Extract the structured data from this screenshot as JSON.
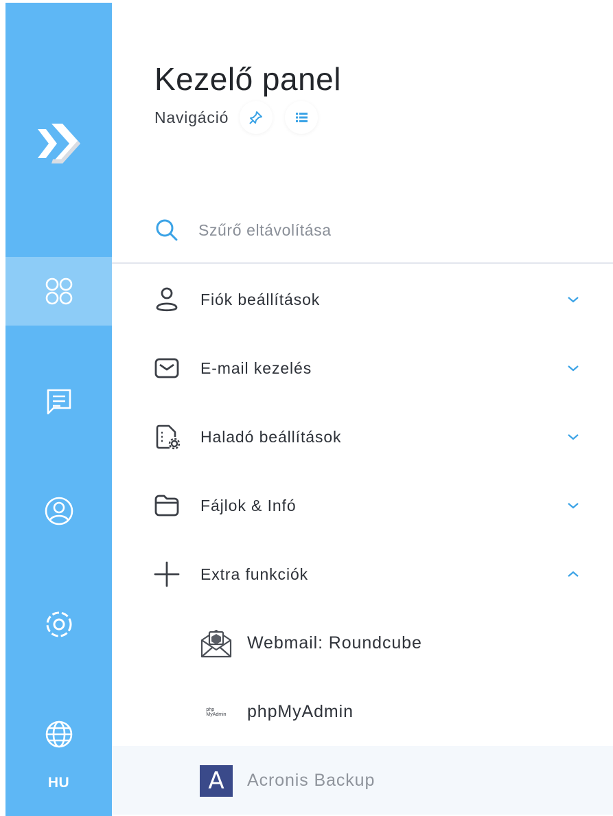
{
  "header": {
    "title": "Kezelő panel",
    "subtitle": "Navigáció"
  },
  "search": {
    "placeholder": "Szűrő eltávolítása"
  },
  "rail": {
    "items": [
      {
        "icon": "grid-icon",
        "active": true
      },
      {
        "icon": "message-icon",
        "active": false
      },
      {
        "icon": "user-circle-icon",
        "active": false
      },
      {
        "icon": "settings-icon",
        "active": false
      },
      {
        "icon": "globe-icon",
        "active": false
      }
    ],
    "language": "HU"
  },
  "menu": [
    {
      "label": "Fiók beállítások",
      "icon": "user-icon",
      "expanded": false
    },
    {
      "label": "E-mail kezelés",
      "icon": "mail-icon",
      "expanded": false
    },
    {
      "label": "Haladó beállítások",
      "icon": "document-settings-icon",
      "expanded": false
    },
    {
      "label": "Fájlok & Infó",
      "icon": "folder-icon",
      "expanded": false
    },
    {
      "label": "Extra funkciók",
      "icon": "plus-icon",
      "expanded": true
    }
  ],
  "extra": [
    {
      "label": "Webmail: Roundcube",
      "icon": "roundcube-icon"
    },
    {
      "label": "phpMyAdmin",
      "icon": "phpmyadmin-icon",
      "logo_text": [
        "php",
        "MyAdmin"
      ]
    },
    {
      "label": "Acronis Backup",
      "icon": "acronis-icon",
      "logo_text": "A",
      "selected": true
    }
  ],
  "colors": {
    "rail": "#5eb7f5",
    "rail_active": "#8dccf7",
    "accent": "#3ba3e6",
    "icon": "#3b3f46"
  }
}
